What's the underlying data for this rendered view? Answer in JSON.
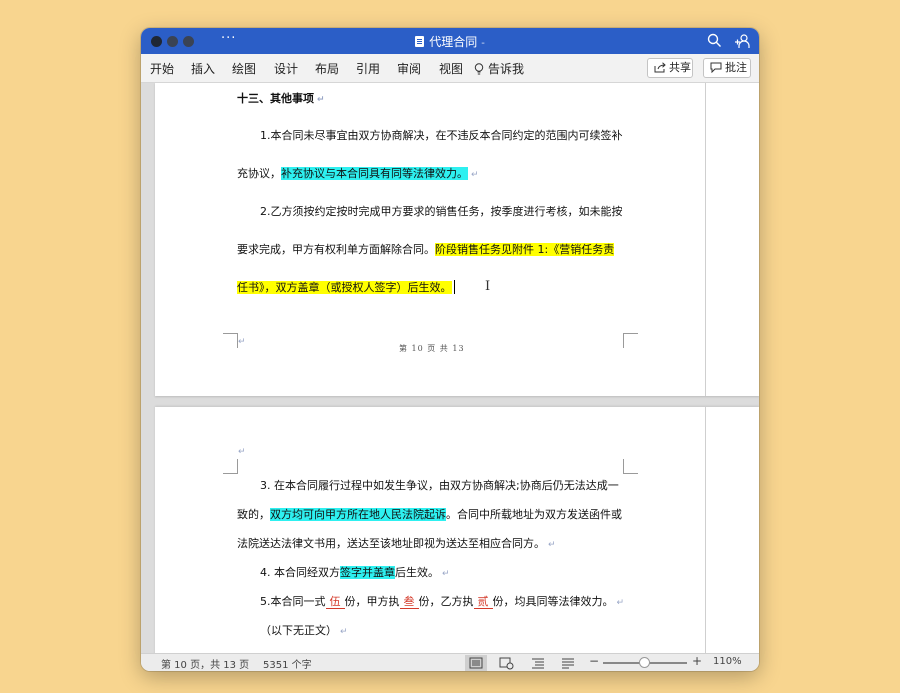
{
  "window": {
    "title": "代理合同",
    "title_caret": "-",
    "more_label": "···"
  },
  "ribbon": {
    "tabs": [
      "开始",
      "插入",
      "绘图",
      "设计",
      "布局",
      "引用",
      "审阅",
      "视图"
    ],
    "tell_me": "告诉我",
    "share_label": "共享",
    "comment_label": "批注"
  },
  "page1": {
    "heading": "十三、其他事项",
    "p1_line1": "1.本合同未尽事宜由双方协商解决，在不违反本合同约定的范围内可续签补",
    "p1_line2_pre": "充协议，",
    "p1_line2_hl": "补充协议与本合同具有同等法律效力。",
    "p2_line1": "2.乙方须按约定按时完成甲方要求的销售任务，按季度进行考核，如未能按",
    "p2_line2_pre": "要求完成，甲方有权利单方面解除合同。",
    "p2_line2_hl": "阶段销售任务见附件 1:《营销任务责",
    "p2_line3_hl": "任书》，双方盖章（或授权人签字）后生效。",
    "footer": "第 10 页 共 13"
  },
  "page2": {
    "p3_line1": "3. 在本合同履行过程中如发生争议，由双方协商解决;协商后仍无法达成一",
    "p3_line2_pre": "致的，",
    "p3_line2_hl": "双方均可向甲方所在地人民法院起诉",
    "p3_line2_post": "。合同中所载地址为双方发送函件或",
    "p3_line3": "法院送达法律文书用，送达至该地址即视为送达至相应合同方。",
    "p4_pre": "4. 本合同经双方",
    "p4_hl": "签字并盖章",
    "p4_post": "后生效。",
    "p5_a": "5.本合同一式",
    "p5_n1": "伍",
    "p5_b": "份，甲方执",
    "p5_n2": "叁",
    "p5_c": "份，乙方执",
    "p5_n3": "贰",
    "p5_d": "份，均具同等法律效力。",
    "p6": "（以下无正文）"
  },
  "status": {
    "page_info": "第 10 页，共 13 页",
    "word_count": "5351 个字",
    "zoom_minus": "−",
    "zoom_plus": "+",
    "zoom": "110%",
    "zoom_level_percent": 110
  },
  "colors": {
    "titlebar": "#2b5ec7",
    "highlight_cyan": "#2ef0f0",
    "highlight_yellow": "#ffff00",
    "desktop": "#f8d58f"
  }
}
